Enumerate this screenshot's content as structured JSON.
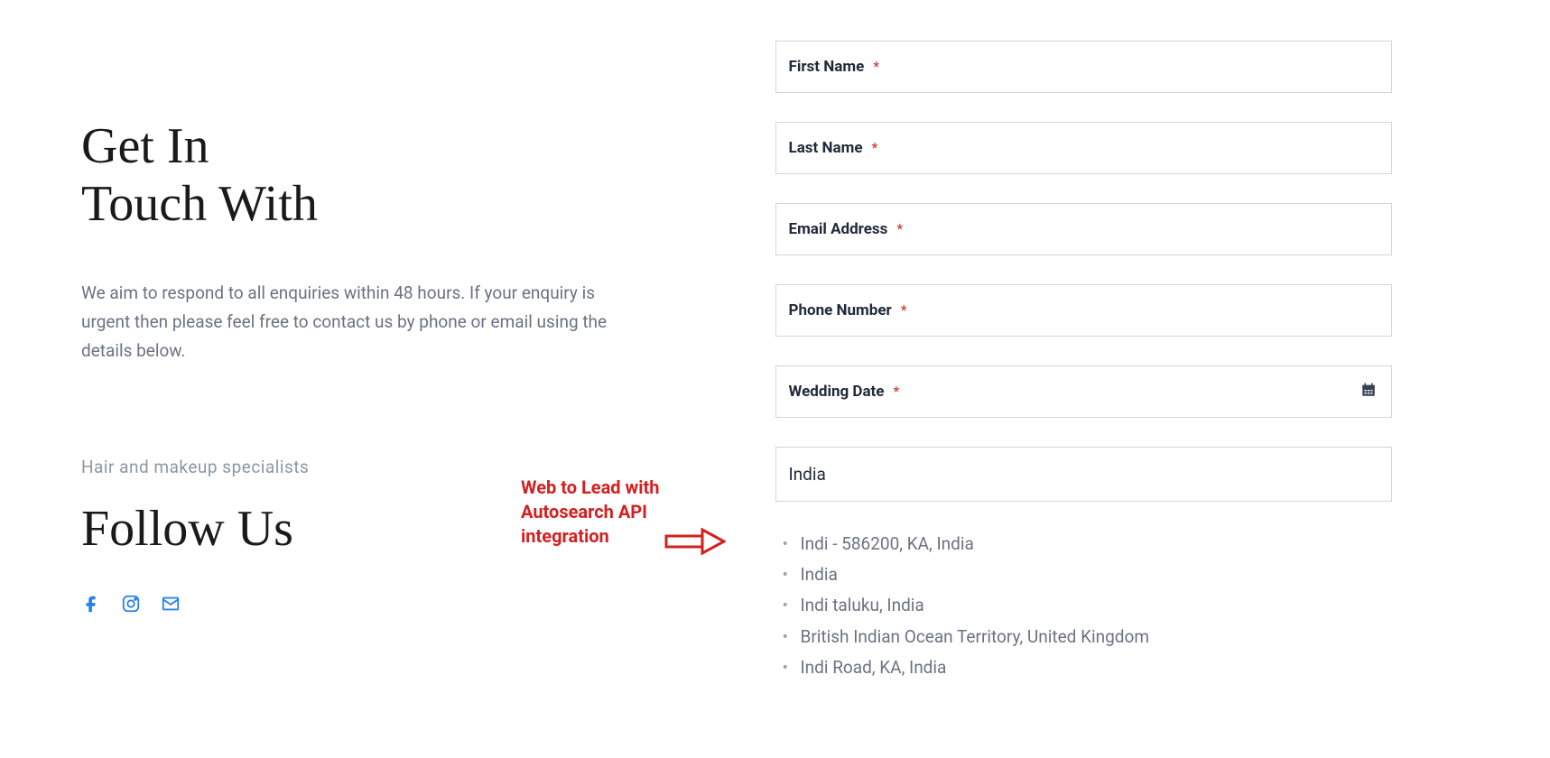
{
  "left": {
    "heading_line1": "Get In",
    "heading_line2": "Touch With",
    "intro": "We aim to respond to all enquiries within 48 hours. If your enquiry is urgent then please feel free to contact us by phone or email using the details below.",
    "specialists": "Hair and makeup specialists",
    "follow_heading": "Follow Us"
  },
  "form": {
    "first_name_label": "First Name",
    "last_name_label": "Last Name",
    "email_label": "Email Address",
    "phone_label": "Phone Number",
    "wedding_date_label": "Wedding Date",
    "asterisk": "*",
    "search_value": "India",
    "autocomplete": [
      "Indi - 586200, KA, India",
      "India",
      "Indi taluku, India",
      "British Indian Ocean Territory, United Kingdom",
      "Indi Road, KA, India"
    ]
  },
  "annotation": {
    "line1": "Web to Lead with",
    "line2": "Autosearch API",
    "line3": "integration"
  }
}
